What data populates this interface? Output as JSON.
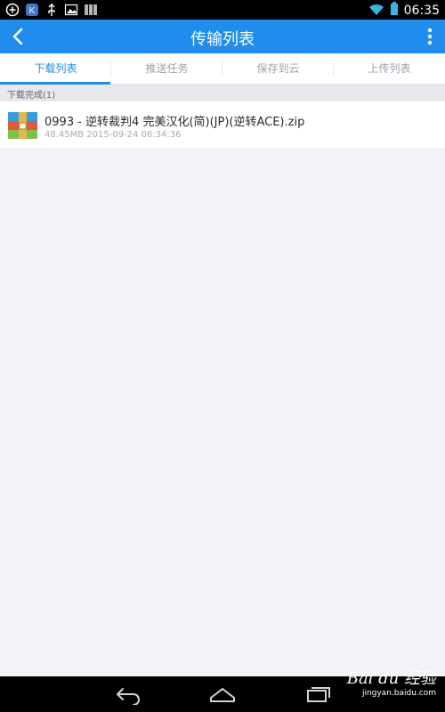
{
  "status_bar": {
    "time": "06:35",
    "icons": [
      "add-circle-icon",
      "app-k-icon",
      "usb-icon",
      "image-icon",
      "barcode-icon",
      "wifi-icon",
      "battery-icon"
    ]
  },
  "app_bar": {
    "title": "传输列表",
    "icons": [
      "back-arrow-icon",
      "more-vert-icon"
    ]
  },
  "tabs": [
    {
      "label": "下载列表",
      "active": true
    },
    {
      "label": "推送任务",
      "active": false
    },
    {
      "label": "保存到云",
      "active": false
    },
    {
      "label": "上传列表",
      "active": false
    }
  ],
  "section": {
    "label": "下载完成(1)"
  },
  "items": [
    {
      "icon": "zip-archive-icon",
      "name": "0993 - 逆转裁判4 完美汉化(简)(JP)(逆转ACE).zip",
      "meta": "48.45MB 2015-09-24 06:34:36"
    }
  ],
  "nav_bar": {
    "icons": [
      "back-nav-icon",
      "home-nav-icon",
      "recents-nav-icon"
    ]
  },
  "watermark": {
    "main": "Bai du 经验",
    "sub": "jingyan.baidu.com"
  },
  "colors": {
    "accent": "#1f8ded",
    "background": "#f1f3f6",
    "status_bar": "#000000"
  }
}
